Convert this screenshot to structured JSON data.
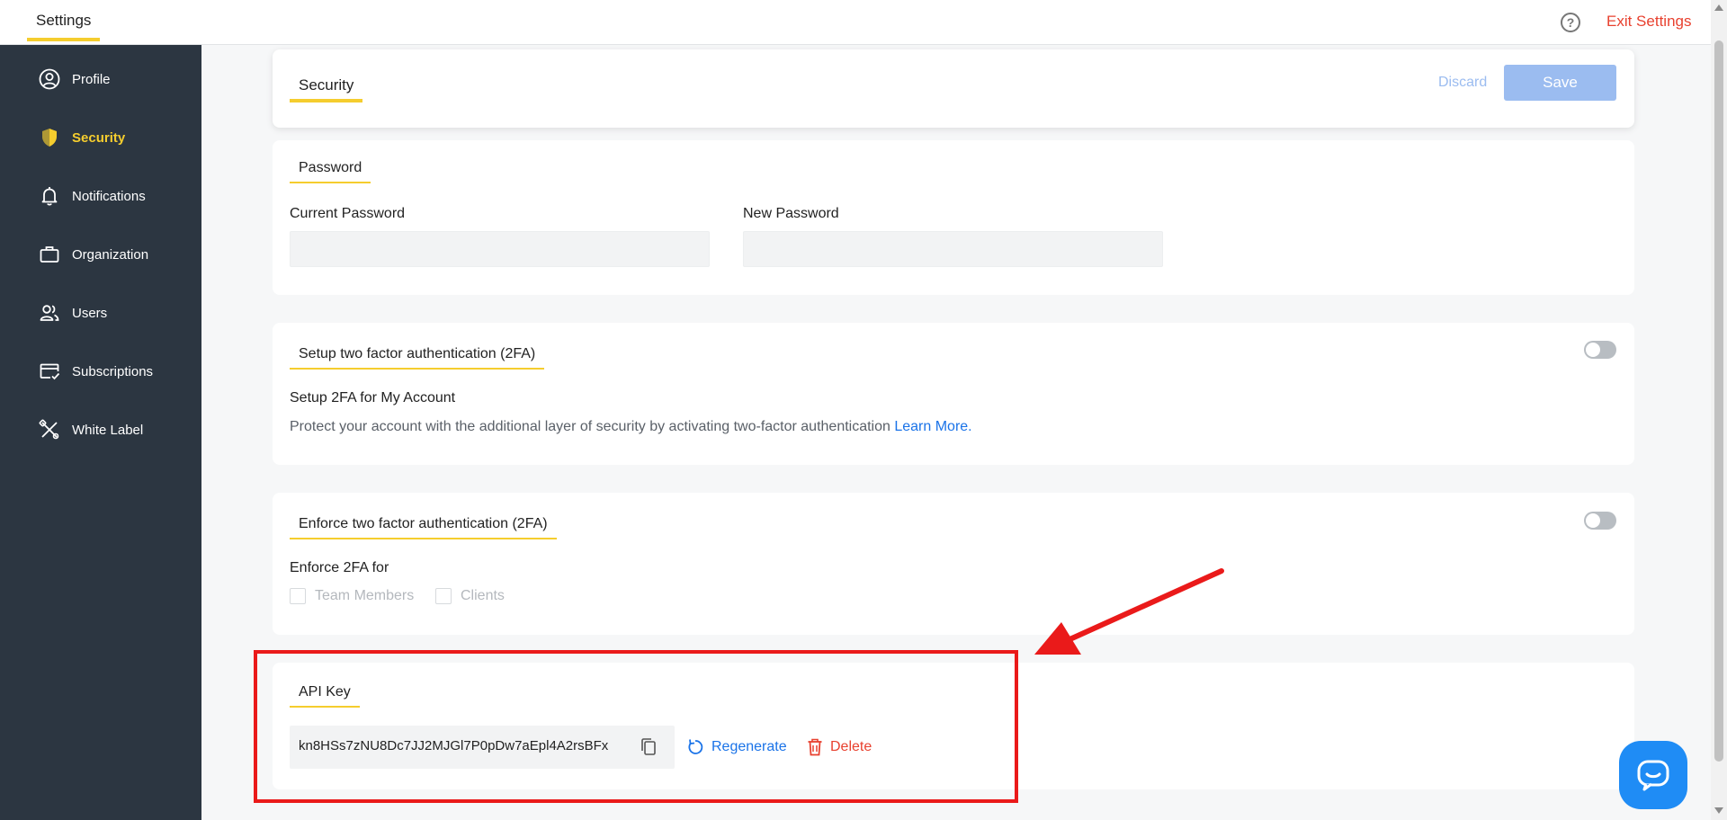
{
  "topbar": {
    "tab_label": "Settings",
    "help_icon": "question-circle-icon",
    "exit_label": "Exit Settings"
  },
  "sidebar": {
    "items": [
      {
        "label": "Profile",
        "icon": "user-circle-icon",
        "active": false
      },
      {
        "label": "Security",
        "icon": "shield-icon",
        "active": true
      },
      {
        "label": "Notifications",
        "icon": "bell-icon",
        "active": false
      },
      {
        "label": "Organization",
        "icon": "briefcase-icon",
        "active": false
      },
      {
        "label": "Users",
        "icon": "users-icon",
        "active": false
      },
      {
        "label": "Subscriptions",
        "icon": "credit-card-check-icon",
        "active": false
      },
      {
        "label": "White Label",
        "icon": "tools-icon",
        "active": false
      }
    ]
  },
  "header": {
    "title": "Security",
    "discard_label": "Discard",
    "save_label": "Save"
  },
  "password": {
    "section_title": "Password",
    "current_label": "Current Password",
    "current_value": "",
    "new_label": "New Password",
    "new_value": ""
  },
  "setup_2fa": {
    "section_title": "Setup two factor authentication (2FA)",
    "subtitle": "Setup 2FA for My Account",
    "description": "Protect your account with the additional layer of security by activating two-factor authentication",
    "learn_more": "Learn More.",
    "enabled": false
  },
  "enforce_2fa": {
    "section_title": "Enforce two factor authentication (2FA)",
    "subtitle": "Enforce 2FA for",
    "options": [
      {
        "label": "Team Members",
        "checked": false
      },
      {
        "label": "Clients",
        "checked": false
      }
    ],
    "enabled": false
  },
  "api_key": {
    "section_title": "API Key",
    "value": "kn8HSs7zNU8Dc7JJ2MJGl7P0pDw7aEpl4A2rsBFx",
    "copy_icon": "copy-icon",
    "regenerate_label": "Regenerate",
    "regenerate_icon": "refresh-icon",
    "delete_label": "Delete",
    "delete_icon": "trash-icon"
  },
  "colors": {
    "accent": "#f5cd2e",
    "sidebar_bg": "#2c3641",
    "link": "#1a73e8",
    "danger": "#e8412f",
    "annotation": "#ea1a1a"
  }
}
